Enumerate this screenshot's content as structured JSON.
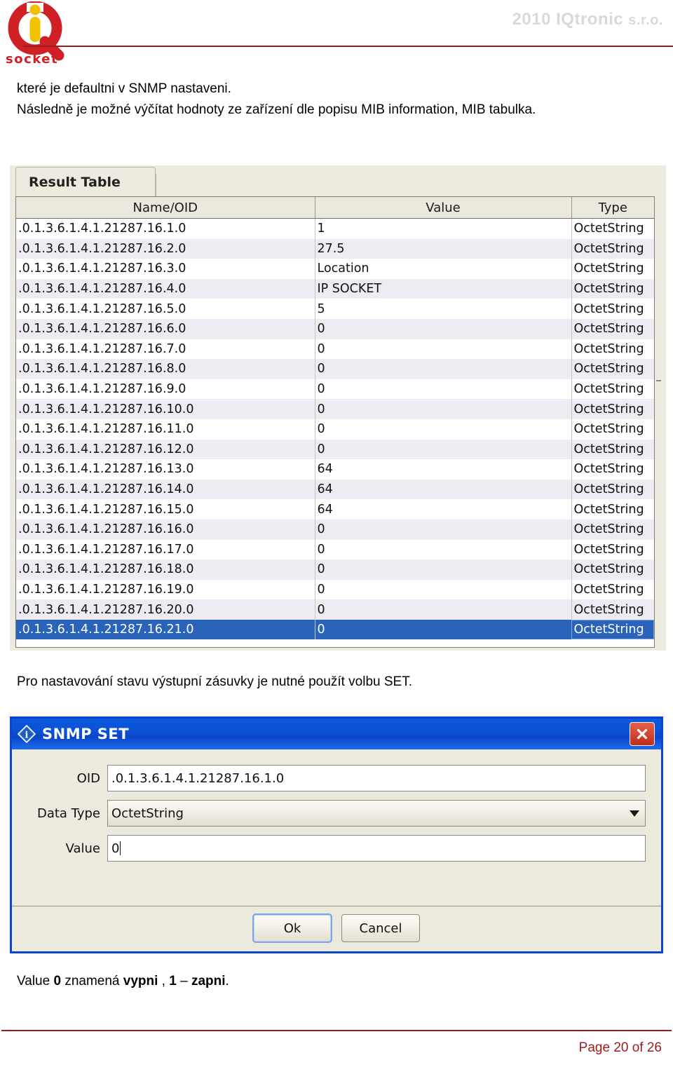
{
  "header": {
    "copyright_year": "2010",
    "company": "IQtronic",
    "legal_form": "s.r.o.",
    "logo_text": "socket",
    "logo_letter": "i"
  },
  "paragraphs": {
    "intro": "které je defaultni v SNMP nastaveni.\nNásledně je možné výčítat hodnoty ze zařízení dle popisu MIB information, MIB tabulka.",
    "middle": "Pro nastavování stavu výstupní zásuvky je nutné použít volbu SET."
  },
  "bottom_note": {
    "prefix": "Value ",
    "zero": "0",
    "mid1": " znamená ",
    "off": "vypni",
    "mid2": " , ",
    "one": "1",
    "dash": " – ",
    "on": "zapni",
    "suffix": "."
  },
  "result_table": {
    "tab_label": "Result Table",
    "columns": [
      "Name/OID",
      "Value",
      "Type"
    ],
    "rows": [
      {
        "oid": ".0.1.3.6.1.4.1.21287.16.1.0",
        "value": "1",
        "type": "OctetString",
        "selected": false
      },
      {
        "oid": ".0.1.3.6.1.4.1.21287.16.2.0",
        "value": "27.5",
        "type": "OctetString",
        "selected": false
      },
      {
        "oid": ".0.1.3.6.1.4.1.21287.16.3.0",
        "value": "Location",
        "type": "OctetString",
        "selected": false
      },
      {
        "oid": ".0.1.3.6.1.4.1.21287.16.4.0",
        "value": "IP SOCKET",
        "type": "OctetString",
        "selected": false
      },
      {
        "oid": ".0.1.3.6.1.4.1.21287.16.5.0",
        "value": "5",
        "type": "OctetString",
        "selected": false
      },
      {
        "oid": ".0.1.3.6.1.4.1.21287.16.6.0",
        "value": "0",
        "type": "OctetString",
        "selected": false
      },
      {
        "oid": ".0.1.3.6.1.4.1.21287.16.7.0",
        "value": "0",
        "type": "OctetString",
        "selected": false
      },
      {
        "oid": ".0.1.3.6.1.4.1.21287.16.8.0",
        "value": "0",
        "type": "OctetString",
        "selected": false
      },
      {
        "oid": ".0.1.3.6.1.4.1.21287.16.9.0",
        "value": "0",
        "type": "OctetString",
        "selected": false
      },
      {
        "oid": ".0.1.3.6.1.4.1.21287.16.10.0",
        "value": "0",
        "type": "OctetString",
        "selected": false
      },
      {
        "oid": ".0.1.3.6.1.4.1.21287.16.11.0",
        "value": "0",
        "type": "OctetString",
        "selected": false
      },
      {
        "oid": ".0.1.3.6.1.4.1.21287.16.12.0",
        "value": "0",
        "type": "OctetString",
        "selected": false
      },
      {
        "oid": ".0.1.3.6.1.4.1.21287.16.13.0",
        "value": "64",
        "type": "OctetString",
        "selected": false
      },
      {
        "oid": ".0.1.3.6.1.4.1.21287.16.14.0",
        "value": "64",
        "type": "OctetString",
        "selected": false
      },
      {
        "oid": ".0.1.3.6.1.4.1.21287.16.15.0",
        "value": "64",
        "type": "OctetString",
        "selected": false
      },
      {
        "oid": ".0.1.3.6.1.4.1.21287.16.16.0",
        "value": "0",
        "type": "OctetString",
        "selected": false
      },
      {
        "oid": ".0.1.3.6.1.4.1.21287.16.17.0",
        "value": "0",
        "type": "OctetString",
        "selected": false
      },
      {
        "oid": ".0.1.3.6.1.4.1.21287.16.18.0",
        "value": "0",
        "type": "OctetString",
        "selected": false
      },
      {
        "oid": ".0.1.3.6.1.4.1.21287.16.19.0",
        "value": "0",
        "type": "OctetString",
        "selected": false
      },
      {
        "oid": ".0.1.3.6.1.4.1.21287.16.20.0",
        "value": "0",
        "type": "OctetString",
        "selected": false
      },
      {
        "oid": ".0.1.3.6.1.4.1.21287.16.21.0",
        "value": "0",
        "type": "OctetString",
        "selected": true
      }
    ]
  },
  "snmp_set_dialog": {
    "title": "SNMP SET",
    "icon": "info-diamond-icon",
    "close_icon": "close-icon",
    "fields": {
      "oid_label": "OID",
      "oid_value": ".0.1.3.6.1.4.1.21287.16.1.0",
      "datatype_label": "Data Type",
      "datatype_value": "OctetString",
      "value_label": "Value",
      "value_value": "0"
    },
    "buttons": {
      "ok": "Ok",
      "cancel": "Cancel"
    }
  },
  "footer": {
    "page_text": "Page 20 of 26"
  },
  "colors": {
    "brand_red": "#9e1b1b",
    "logo_red": "#cf2026",
    "logo_yellow": "#f2c200",
    "titlebar_blue": "#0a46c8",
    "selection_blue": "#2a63ba"
  }
}
